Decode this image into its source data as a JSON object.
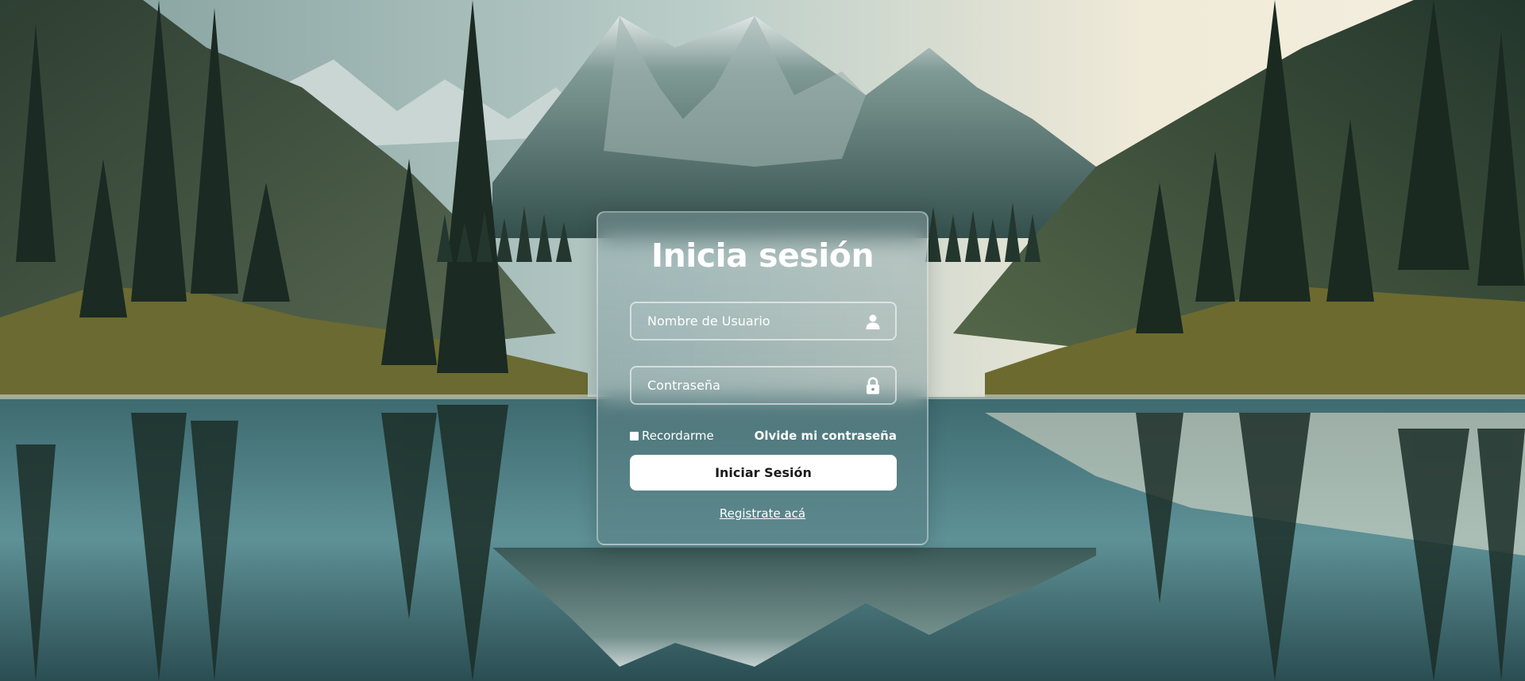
{
  "login": {
    "title": "Inicia sesión",
    "username_placeholder": "Nombre de Usuario",
    "username_value": "",
    "password_placeholder": "Contraseña",
    "password_value": "",
    "remember_label": "Recordarme",
    "remember_checked": false,
    "forgot_label": "Olvide mi contraseña",
    "submit_label": "Iniciar Sesión",
    "register_label": "Registrate acá"
  },
  "icons": {
    "username": "user-icon",
    "password": "lock-icon"
  },
  "colors": {
    "card_border": "#ffffffa0",
    "button_bg": "#ffffff",
    "button_text": "#1a1a1a",
    "text": "#ffffff"
  }
}
